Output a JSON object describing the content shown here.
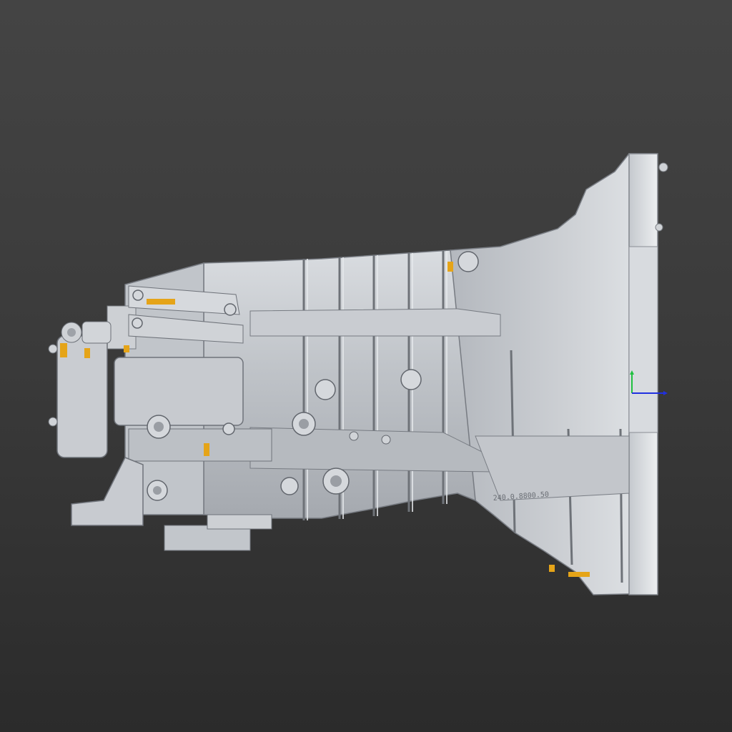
{
  "viewport": {
    "background_top": "#444444",
    "background_bottom": "#2b2b2b"
  },
  "model": {
    "surface_color": "#b9bdc3",
    "highlight_color": "#e6e9ed",
    "shadow_color": "#6d7178",
    "deviation_marker_color": "#e5a418",
    "cast_marking_text": "240.0.8800.50"
  },
  "axis_gizmo": {
    "x_axis_color": "#2030e0",
    "y_axis_color": "#20c040"
  }
}
